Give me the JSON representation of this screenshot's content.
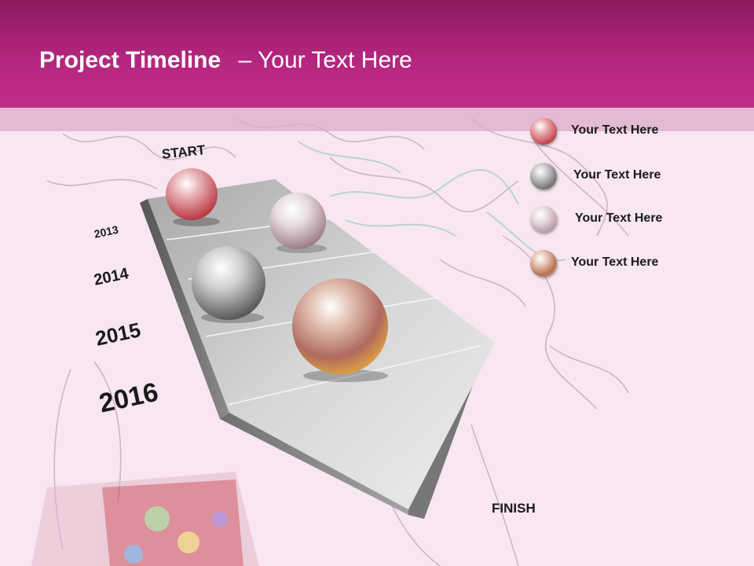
{
  "header": {
    "title_main": "Project Timeline",
    "title_sub": "– Your Text Here"
  },
  "timeline": {
    "start_label": "START",
    "finish_label": "FINISH",
    "years": [
      "2013",
      "2014",
      "2015",
      "2016"
    ]
  },
  "legend": [
    {
      "label": "Your  Text Here",
      "color": "#c0404a"
    },
    {
      "label": "Your  Text Here",
      "color": "#6e6e6e"
    },
    {
      "label": "Your  Text Here",
      "color": "#b89aa4"
    },
    {
      "label": "Your  Text Here",
      "color": "#c98a3e"
    }
  ],
  "colors": {
    "header": "#b4267f",
    "background": "#f8e6f1",
    "sphere_red": "#c0404a",
    "sphere_gray": "#6e6e6e",
    "sphere_mauve": "#b89aa4",
    "sphere_orange": "#c98a3e"
  }
}
